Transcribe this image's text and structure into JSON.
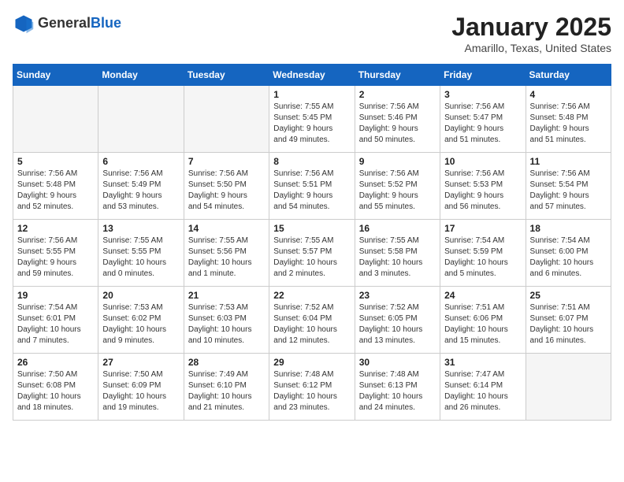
{
  "header": {
    "logo_general": "General",
    "logo_blue": "Blue",
    "title": "January 2025",
    "subtitle": "Amarillo, Texas, United States"
  },
  "weekdays": [
    "Sunday",
    "Monday",
    "Tuesday",
    "Wednesday",
    "Thursday",
    "Friday",
    "Saturday"
  ],
  "weeks": [
    [
      {
        "day": "",
        "info": ""
      },
      {
        "day": "",
        "info": ""
      },
      {
        "day": "",
        "info": ""
      },
      {
        "day": "1",
        "info": "Sunrise: 7:55 AM\nSunset: 5:45 PM\nDaylight: 9 hours\nand 49 minutes."
      },
      {
        "day": "2",
        "info": "Sunrise: 7:56 AM\nSunset: 5:46 PM\nDaylight: 9 hours\nand 50 minutes."
      },
      {
        "day": "3",
        "info": "Sunrise: 7:56 AM\nSunset: 5:47 PM\nDaylight: 9 hours\nand 51 minutes."
      },
      {
        "day": "4",
        "info": "Sunrise: 7:56 AM\nSunset: 5:48 PM\nDaylight: 9 hours\nand 51 minutes."
      }
    ],
    [
      {
        "day": "5",
        "info": "Sunrise: 7:56 AM\nSunset: 5:48 PM\nDaylight: 9 hours\nand 52 minutes."
      },
      {
        "day": "6",
        "info": "Sunrise: 7:56 AM\nSunset: 5:49 PM\nDaylight: 9 hours\nand 53 minutes."
      },
      {
        "day": "7",
        "info": "Sunrise: 7:56 AM\nSunset: 5:50 PM\nDaylight: 9 hours\nand 54 minutes."
      },
      {
        "day": "8",
        "info": "Sunrise: 7:56 AM\nSunset: 5:51 PM\nDaylight: 9 hours\nand 54 minutes."
      },
      {
        "day": "9",
        "info": "Sunrise: 7:56 AM\nSunset: 5:52 PM\nDaylight: 9 hours\nand 55 minutes."
      },
      {
        "day": "10",
        "info": "Sunrise: 7:56 AM\nSunset: 5:53 PM\nDaylight: 9 hours\nand 56 minutes."
      },
      {
        "day": "11",
        "info": "Sunrise: 7:56 AM\nSunset: 5:54 PM\nDaylight: 9 hours\nand 57 minutes."
      }
    ],
    [
      {
        "day": "12",
        "info": "Sunrise: 7:56 AM\nSunset: 5:55 PM\nDaylight: 9 hours\nand 59 minutes."
      },
      {
        "day": "13",
        "info": "Sunrise: 7:55 AM\nSunset: 5:55 PM\nDaylight: 10 hours\nand 0 minutes."
      },
      {
        "day": "14",
        "info": "Sunrise: 7:55 AM\nSunset: 5:56 PM\nDaylight: 10 hours\nand 1 minute."
      },
      {
        "day": "15",
        "info": "Sunrise: 7:55 AM\nSunset: 5:57 PM\nDaylight: 10 hours\nand 2 minutes."
      },
      {
        "day": "16",
        "info": "Sunrise: 7:55 AM\nSunset: 5:58 PM\nDaylight: 10 hours\nand 3 minutes."
      },
      {
        "day": "17",
        "info": "Sunrise: 7:54 AM\nSunset: 5:59 PM\nDaylight: 10 hours\nand 5 minutes."
      },
      {
        "day": "18",
        "info": "Sunrise: 7:54 AM\nSunset: 6:00 PM\nDaylight: 10 hours\nand 6 minutes."
      }
    ],
    [
      {
        "day": "19",
        "info": "Sunrise: 7:54 AM\nSunset: 6:01 PM\nDaylight: 10 hours\nand 7 minutes."
      },
      {
        "day": "20",
        "info": "Sunrise: 7:53 AM\nSunset: 6:02 PM\nDaylight: 10 hours\nand 9 minutes."
      },
      {
        "day": "21",
        "info": "Sunrise: 7:53 AM\nSunset: 6:03 PM\nDaylight: 10 hours\nand 10 minutes."
      },
      {
        "day": "22",
        "info": "Sunrise: 7:52 AM\nSunset: 6:04 PM\nDaylight: 10 hours\nand 12 minutes."
      },
      {
        "day": "23",
        "info": "Sunrise: 7:52 AM\nSunset: 6:05 PM\nDaylight: 10 hours\nand 13 minutes."
      },
      {
        "day": "24",
        "info": "Sunrise: 7:51 AM\nSunset: 6:06 PM\nDaylight: 10 hours\nand 15 minutes."
      },
      {
        "day": "25",
        "info": "Sunrise: 7:51 AM\nSunset: 6:07 PM\nDaylight: 10 hours\nand 16 minutes."
      }
    ],
    [
      {
        "day": "26",
        "info": "Sunrise: 7:50 AM\nSunset: 6:08 PM\nDaylight: 10 hours\nand 18 minutes."
      },
      {
        "day": "27",
        "info": "Sunrise: 7:50 AM\nSunset: 6:09 PM\nDaylight: 10 hours\nand 19 minutes."
      },
      {
        "day": "28",
        "info": "Sunrise: 7:49 AM\nSunset: 6:10 PM\nDaylight: 10 hours\nand 21 minutes."
      },
      {
        "day": "29",
        "info": "Sunrise: 7:48 AM\nSunset: 6:12 PM\nDaylight: 10 hours\nand 23 minutes."
      },
      {
        "day": "30",
        "info": "Sunrise: 7:48 AM\nSunset: 6:13 PM\nDaylight: 10 hours\nand 24 minutes."
      },
      {
        "day": "31",
        "info": "Sunrise: 7:47 AM\nSunset: 6:14 PM\nDaylight: 10 hours\nand 26 minutes."
      },
      {
        "day": "",
        "info": ""
      }
    ]
  ]
}
